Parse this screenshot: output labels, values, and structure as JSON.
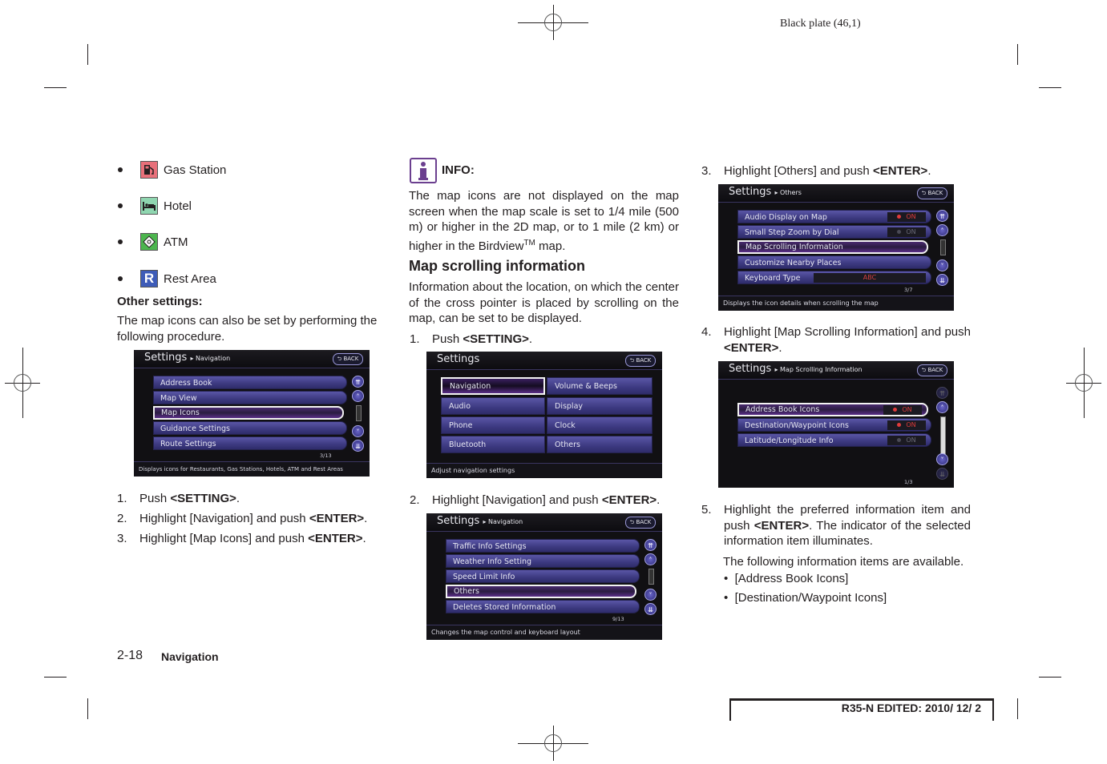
{
  "header": {
    "plate": "Black plate (46,1)"
  },
  "col1": {
    "poi_items": [
      {
        "label": "Gas Station",
        "icon": "gas-station-icon",
        "color": "#e8707a"
      },
      {
        "label": "Hotel",
        "icon": "hotel-icon",
        "color": "#8fd6b0"
      },
      {
        "label": "ATM",
        "icon": "atm-icon",
        "color": "#4cb54e"
      },
      {
        "label": "Rest Area",
        "icon": "rest-area-icon",
        "color": "#3e5cb8",
        "glyph": "R"
      }
    ],
    "other_settings_heading": "Other settings:",
    "other_settings_text": "The map icons can also be set by performing the following procedure.",
    "screen": {
      "title": "Settings",
      "breadcrumb": "▸ Navigation",
      "back": "BACK",
      "items": [
        "Address Book",
        "Map View",
        "Map Icons",
        "Guidance Settings",
        "Route Settings"
      ],
      "selected": "Map Icons",
      "page": "3/13",
      "footer": "Displays icons for Restaurants, Gas Stations, Hotels, ATM and Rest Areas"
    },
    "steps": [
      {
        "n": "1.",
        "pre": "Push ",
        "key": "<SETTING>",
        "post": "."
      },
      {
        "n": "2.",
        "pre": "Highlight [Navigation] and push ",
        "key": "<ENTER>",
        "post": "."
      },
      {
        "n": "3.",
        "pre": "Highlight [Map Icons] and push ",
        "key": "<ENTER>",
        "post": "."
      }
    ]
  },
  "col2": {
    "info_heading": "INFO:",
    "info_text_pre": "The map icons are not displayed on the map screen when the map scale is set to 1/4 mile (500 m) or higher in the 2D map, or to 1 mile (2 km) or higher in the Birdview",
    "info_tm": "TM",
    "info_text_post": " map.",
    "section_title": "Map scrolling information",
    "section_text": "Information about the location, on which the center of the cross pointer is placed by scrolling on the map, can be set to be displayed.",
    "step1": {
      "n": "1.",
      "pre": "Push ",
      "key": "<SETTING>",
      "post": "."
    },
    "screen1": {
      "title": "Settings",
      "back": "BACK",
      "left_items": [
        "Navigation",
        "Audio",
        "Phone",
        "Bluetooth"
      ],
      "right_items": [
        "Volume & Beeps",
        "Display",
        "Clock",
        "Others"
      ],
      "selected": "Navigation",
      "footer": "Adjust navigation settings"
    },
    "step2": {
      "n": "2.",
      "pre": "Highlight [Navigation] and push ",
      "key": "<ENTER>",
      "post": "."
    },
    "screen2": {
      "title": "Settings",
      "breadcrumb": "▸ Navigation",
      "back": "BACK",
      "items": [
        "Traffic Info Settings",
        "Weather Info Setting",
        "Speed Limit Info",
        "Others",
        "Deletes Stored Information"
      ],
      "selected": "Others",
      "page": "9/13",
      "footer": "Changes the map control and keyboard layout"
    }
  },
  "col3": {
    "step3": {
      "n": "3.",
      "pre": "Highlight [Others] and push ",
      "key": "<ENTER>",
      "post": "."
    },
    "screen3": {
      "title": "Settings",
      "breadcrumb": "▸ Others",
      "back": "BACK",
      "items": [
        {
          "label": "Audio Display on Map",
          "toggle": "ON",
          "on": true
        },
        {
          "label": "Small Step Zoom by Dial",
          "toggle": "ON",
          "on": false
        },
        {
          "label": "Map Scrolling Information"
        },
        {
          "label": "Customize Nearby Places"
        },
        {
          "label": "Keyboard Type",
          "value": "ABC"
        }
      ],
      "selected": "Map Scrolling Information",
      "page": "3/7",
      "footer": "Displays the icon details when scrolling the map"
    },
    "step4": {
      "n": "4.",
      "pre": "Highlight [Map Scrolling Information] and push ",
      "key": "<ENTER>",
      "post": "."
    },
    "screen4": {
      "title": "Settings",
      "breadcrumb": "▸ Map Scrolling Information",
      "back": "BACK",
      "items": [
        {
          "label": "Address Book Icons",
          "toggle": "ON",
          "on": true
        },
        {
          "label": "Destination/Waypoint Icons",
          "toggle": "ON",
          "on": true
        },
        {
          "label": "Latitude/Longitude Info",
          "toggle": "ON",
          "on": false
        }
      ],
      "selected": "Address Book Icons",
      "page": "1/3"
    },
    "step5": {
      "n": "5.",
      "pre": "Highlight the preferred information item and push ",
      "key": "<ENTER>",
      "post": ". The indicator of the selected information item illuminates."
    },
    "available_text": "The following information items are available.",
    "available_items": [
      "[Address Book Icons]",
      "[Destination/Waypoint Icons]"
    ]
  },
  "footer": {
    "page_number": "2-18",
    "section": "Navigation",
    "edited": "R35-N EDITED:  2010/ 12/ 2"
  }
}
